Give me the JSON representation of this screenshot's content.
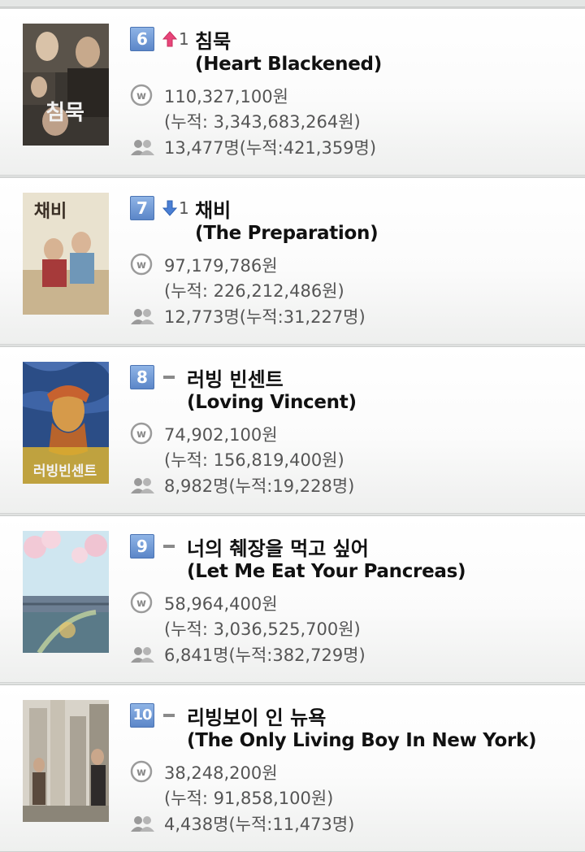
{
  "colors": {
    "rank_badge": "#6b93d3",
    "up_arrow": "#e8457a",
    "down_arrow": "#4a7fd4",
    "text_dark": "#111111",
    "text_gray": "#555555"
  },
  "items": [
    {
      "rank": "6",
      "change_dir": "up",
      "change_num": "1",
      "title_ko": "침묵",
      "title_en": "(Heart Blackened)",
      "revenue": "110,327,100원",
      "revenue_total": "(누적: 3,343,683,264원)",
      "audience": "13,477명(누적:421,359명)",
      "poster_text": "침묵"
    },
    {
      "rank": "7",
      "change_dir": "down",
      "change_num": "1",
      "title_ko": "채비",
      "title_en": "(The Preparation)",
      "revenue": "97,179,786원",
      "revenue_total": "(누적: 226,212,486원)",
      "audience": "12,773명(누적:31,227명)",
      "poster_text": "채비"
    },
    {
      "rank": "8",
      "change_dir": "same",
      "change_num": "",
      "title_ko": "러빙 빈센트",
      "title_en": "(Loving Vincent)",
      "revenue": "74,902,100원",
      "revenue_total": "(누적: 156,819,400원)",
      "audience": "8,982명(누적:19,228명)",
      "poster_text": "러빙빈센트"
    },
    {
      "rank": "9",
      "change_dir": "same",
      "change_num": "",
      "title_ko": "너의 췌장을 먹고 싶어",
      "title_en": "(Let Me Eat Your Pancreas)",
      "revenue": "58,964,400원",
      "revenue_total": "(누적: 3,036,525,700원)",
      "audience": "6,841명(누적:382,729명)",
      "poster_text": ""
    },
    {
      "rank": "10",
      "change_dir": "same",
      "change_num": "",
      "title_ko": "리빙보이 인 뉴욕",
      "title_en": "(The Only Living Boy In New York)",
      "revenue": "38,248,200원",
      "revenue_total": "(누적: 91,858,100원)",
      "audience": "4,438명(누적:11,473명)",
      "poster_text": ""
    }
  ]
}
